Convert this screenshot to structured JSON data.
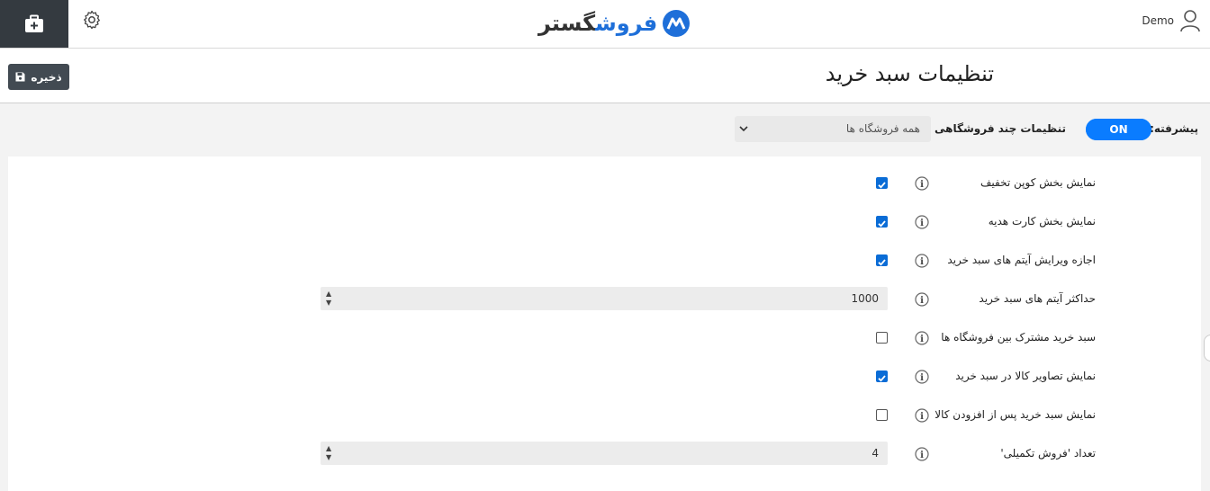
{
  "topbar": {
    "logo_text_main": "گستر",
    "logo_text_accent": "فروش",
    "user_name": "Demo",
    "toolbox_icon": "toolbox-icon",
    "settings_icon": "gear-icon",
    "user_icon": "user-icon"
  },
  "header": {
    "title": "تنظیمات سبد خرید",
    "save_label": "ذخیره",
    "save_icon": "floppy-icon"
  },
  "filters": {
    "advanced_label": "پیشرفته:",
    "advanced_toggle": "ON",
    "multistore_label": "تنظیمات چند فروشگاهی برای:",
    "multistore_value": "همه فروشگاه ها"
  },
  "settings": [
    {
      "label": "نمایش بخش کوپن تخفیف",
      "type": "checkbox",
      "checked": true
    },
    {
      "label": "نمایش بخش کارت هدیه",
      "type": "checkbox",
      "checked": true
    },
    {
      "label": "اجازه ویرایش آیتم های سبد خرید",
      "type": "checkbox",
      "checked": true
    },
    {
      "label": "حداکثر آیتم های سبد خرید",
      "type": "number",
      "value": "1000"
    },
    {
      "label": "سبد خرید مشترک بین فروشگاه ها",
      "type": "checkbox",
      "checked": false
    },
    {
      "label": "نمایش تصاویر کالا در سبد خرید",
      "type": "checkbox",
      "checked": true
    },
    {
      "label": "نمایش سبد خرید پس از افزودن کالا",
      "type": "checkbox",
      "checked": false
    },
    {
      "label": "تعداد 'فروش تکمیلی'",
      "type": "number",
      "value": "4"
    }
  ],
  "colors": {
    "accent": "#0a7cff",
    "dark": "#343a40",
    "checkbox": "#0a6cd6"
  }
}
